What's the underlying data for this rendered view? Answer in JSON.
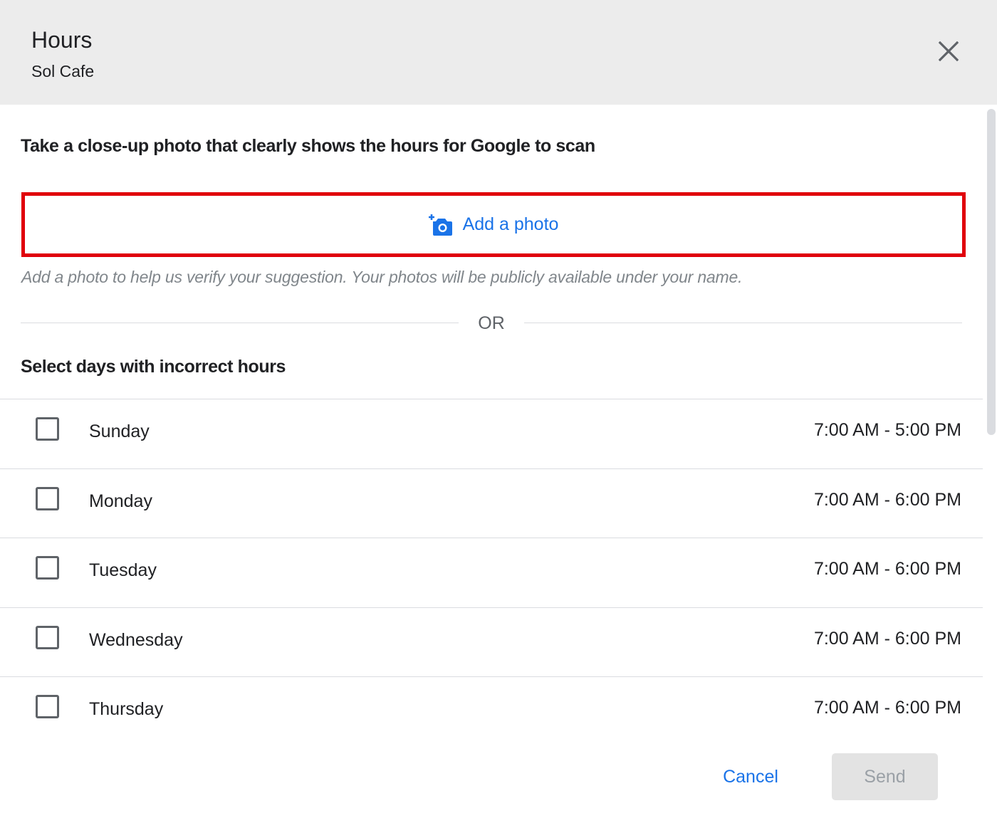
{
  "header": {
    "title": "Hours",
    "subtitle": "Sol Cafe",
    "close_icon": "close-icon"
  },
  "instruction": "Take a close-up photo that clearly shows the hours for Google to scan",
  "add_photo": {
    "label": "Add a photo",
    "icon": "add-a-photo-icon",
    "highlight_color": "#e0000a",
    "accent_color": "#1a73e8"
  },
  "helper_text": "Add a photo to help us verify your suggestion. Your photos will be publicly available under your name.",
  "divider_text": "OR",
  "section_title": "Select days with incorrect hours",
  "days": [
    {
      "name": "Sunday",
      "hours": "7:00 AM - 5:00 PM",
      "checked": false
    },
    {
      "name": "Monday",
      "hours": "7:00 AM - 6:00 PM",
      "checked": false
    },
    {
      "name": "Tuesday",
      "hours": "7:00 AM - 6:00 PM",
      "checked": false
    },
    {
      "name": "Wednesday",
      "hours": "7:00 AM - 6:00 PM",
      "checked": false
    },
    {
      "name": "Thursday",
      "hours": "7:00 AM - 6:00 PM",
      "checked": false
    }
  ],
  "actions": {
    "cancel_label": "Cancel",
    "send_label": "Send"
  }
}
